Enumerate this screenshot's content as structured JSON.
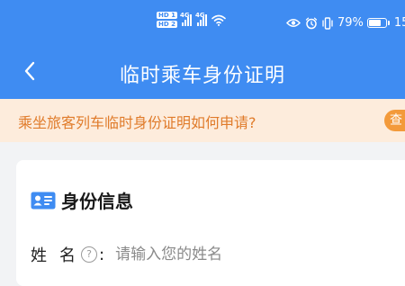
{
  "status_bar": {
    "hd_labels": [
      "HD 1",
      "HD 2"
    ],
    "network_labels": [
      "4G",
      "4G"
    ],
    "battery_percent": "79%",
    "clock_partial": "15",
    "battery_level": 0.79,
    "icons": [
      "hd-icon",
      "signal-icon",
      "wifi-icon",
      "eye-icon",
      "alarm-icon",
      "vibrate-icon",
      "battery-icon"
    ]
  },
  "nav": {
    "title": "临时乘车身份证明",
    "back_icon": "chevron-left-icon"
  },
  "notice": {
    "text": "乘坐旅客列车临时身份证明如何申请?",
    "action_label": "查"
  },
  "card": {
    "section_title": "身份信息",
    "section_icon": "id-card-icon",
    "fields": [
      {
        "label": "姓名",
        "help_icon": "?",
        "colon": ":",
        "placeholder": "请输入您的姓名",
        "value": ""
      }
    ]
  },
  "colors": {
    "header_blue": "#3f8cf2",
    "notice_bg": "#fdecdc",
    "notice_text": "#e07b2a",
    "notice_button": "#f39a3a",
    "page_bg": "#f2f3f5"
  }
}
